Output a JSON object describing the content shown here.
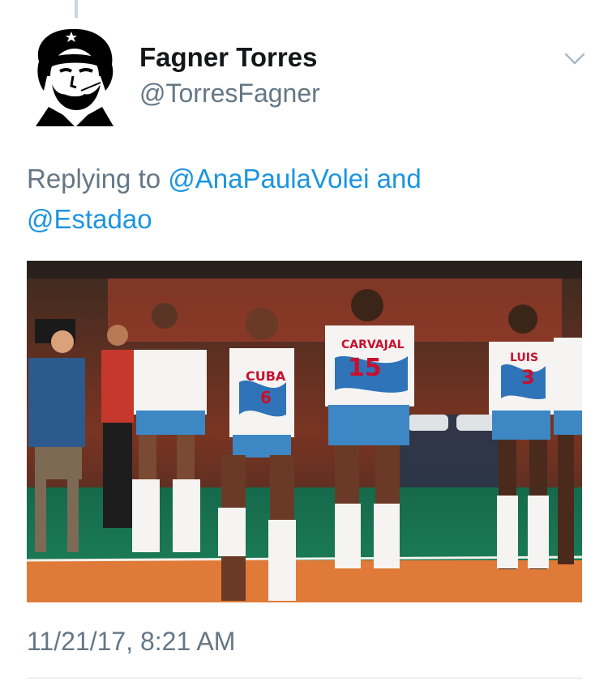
{
  "author": {
    "name": "Fagner Torres",
    "handle": "@TorresFagner"
  },
  "reply": {
    "prefix": "Replying to",
    "mention_1": "@AnaPaulaVolei",
    "conjunction": "and",
    "mention_2": "@Estadao"
  },
  "media": {
    "jerseys": {
      "left_player_team": "CUBA",
      "left_player_number": "6",
      "center_player_name": "CARVAJAL",
      "center_player_number": "15",
      "right_player_name": "LUIS",
      "right_player_number": "3"
    }
  },
  "timestamp": "11/21/17, 8:21 AM",
  "icons": {
    "menu": "chevron-down-icon"
  },
  "colors": {
    "name": "#14171a",
    "secondary": "#657786",
    "link": "#1b95e0",
    "divider": "#d9dee2"
  }
}
